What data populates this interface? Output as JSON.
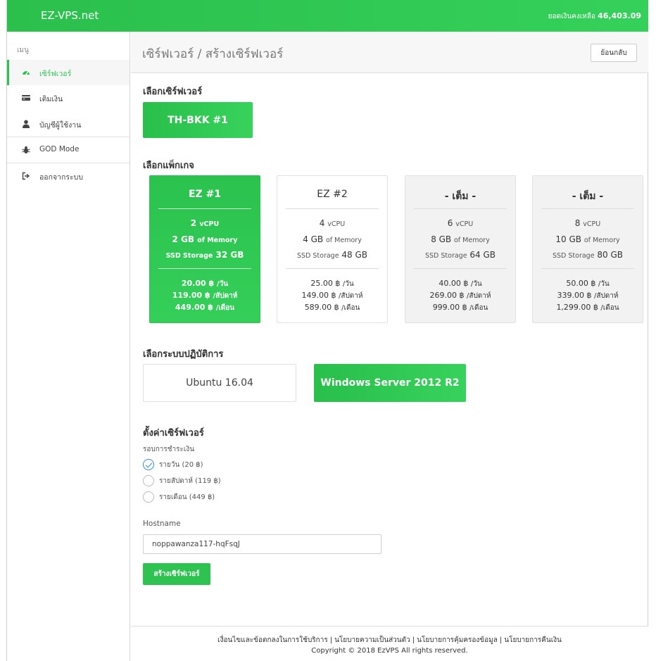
{
  "header": {
    "brand": "EZ-VPS.net",
    "balance_label": "ยอดเงินคงเหลือ",
    "balance_value": "46,403.09",
    "bg_color": "#2ec350"
  },
  "sidebar": {
    "menu_title": "เมนู",
    "items": [
      {
        "label": "เซิร์ฟเวอร์",
        "icon": "dashboard-icon",
        "active": true
      },
      {
        "label": "เติมเงิน",
        "icon": "credit-card-icon",
        "active": false
      },
      {
        "label": "บัญชีผู้ใช้งาน",
        "icon": "user-icon",
        "active": false
      },
      {
        "label": "GOD Mode",
        "icon": "bug-icon",
        "active": false
      },
      {
        "label": "ออกจากระบบ",
        "icon": "sign-out-icon",
        "active": false
      }
    ]
  },
  "page": {
    "title": "เซิร์ฟเวอร์ / สร้างเซิร์ฟเวอร์",
    "back_label": "ย้อนกลับ"
  },
  "server_section": {
    "title": "เลือกเซิร์ฟเวอร์",
    "server_label": "TH-BKK #1"
  },
  "package_section": {
    "title": "เลือกแพ็กเกจ",
    "packages": [
      {
        "name": "EZ #1",
        "vcpu": "2",
        "vcpu_unit": "vCPU",
        "memory": "2 GB",
        "memory_unit": "of Memory",
        "storage_label": "SSD Storage",
        "storage": "32 GB",
        "price_day": "20.00 ฿",
        "day_unit": "/วัน",
        "price_week": "119.00 ฿",
        "week_unit": "/สัปดาห์",
        "price_month": "449.00 ฿",
        "month_unit": "/เดือน",
        "state": "selected"
      },
      {
        "name": "EZ #2",
        "vcpu": "4",
        "vcpu_unit": "vCPU",
        "memory": "4 GB",
        "memory_unit": "of Memory",
        "storage_label": "SSD Storage",
        "storage": "48 GB",
        "price_day": "25.00 ฿",
        "day_unit": "/วัน",
        "price_week": "149.00 ฿",
        "week_unit": "/สัปดาห์",
        "price_month": "589.00 ฿",
        "month_unit": "/เดือน",
        "state": "available"
      },
      {
        "name": "- เต็ม -",
        "vcpu": "6",
        "vcpu_unit": "vCPU",
        "memory": "8 GB",
        "memory_unit": "of Memory",
        "storage_label": "SSD Storage",
        "storage": "64 GB",
        "price_day": "40.00 ฿",
        "day_unit": "/วัน",
        "price_week": "269.00 ฿",
        "week_unit": "/สัปดาห์",
        "price_month": "999.00 ฿",
        "month_unit": "/เดือน",
        "state": "full"
      },
      {
        "name": "- เต็ม -",
        "vcpu": "8",
        "vcpu_unit": "vCPU",
        "memory": "10 GB",
        "memory_unit": "of Memory",
        "storage_label": "SSD Storage",
        "storage": "80 GB",
        "price_day": "50.00 ฿",
        "day_unit": "/วัน",
        "price_week": "339.00 ฿",
        "week_unit": "/สัปดาห์",
        "price_month": "1,299.00 ฿",
        "month_unit": "/เดือน",
        "state": "full"
      }
    ]
  },
  "os_section": {
    "title": "เลือกระบบปฏิบัติการ",
    "options": [
      {
        "label": "Ubuntu 16.04",
        "selected": false
      },
      {
        "label": "Windows Server 2012 R2",
        "selected": true
      }
    ]
  },
  "settings_section": {
    "title": "ตั้งค่าเซิร์ฟเวอร์",
    "billing_label": "รอบการชำระเงิน",
    "billing_options": [
      {
        "label": "รายวัน (20 ฿)",
        "checked": true
      },
      {
        "label": "รายสัปดาห์ (119 ฿)",
        "checked": false
      },
      {
        "label": "รายเดือน (449 ฿)",
        "checked": false
      }
    ],
    "hostname_label": "Hostname",
    "hostname_value": "noppawanza117-hqFsqJ",
    "create_label": "สร้างเซิร์ฟเวอร์"
  },
  "footer": {
    "links": [
      "เงื่อนไขและข้อตกลงในการใช้บริการ",
      "นโยบายความเป็นส่วนตัว",
      "นโยบายการคุ้มครองข้อมูล",
      "นโยบายการคืนเงิน"
    ],
    "separator": "|",
    "copyright": "Copyright © 2018 EzVPS All rights reserved."
  }
}
